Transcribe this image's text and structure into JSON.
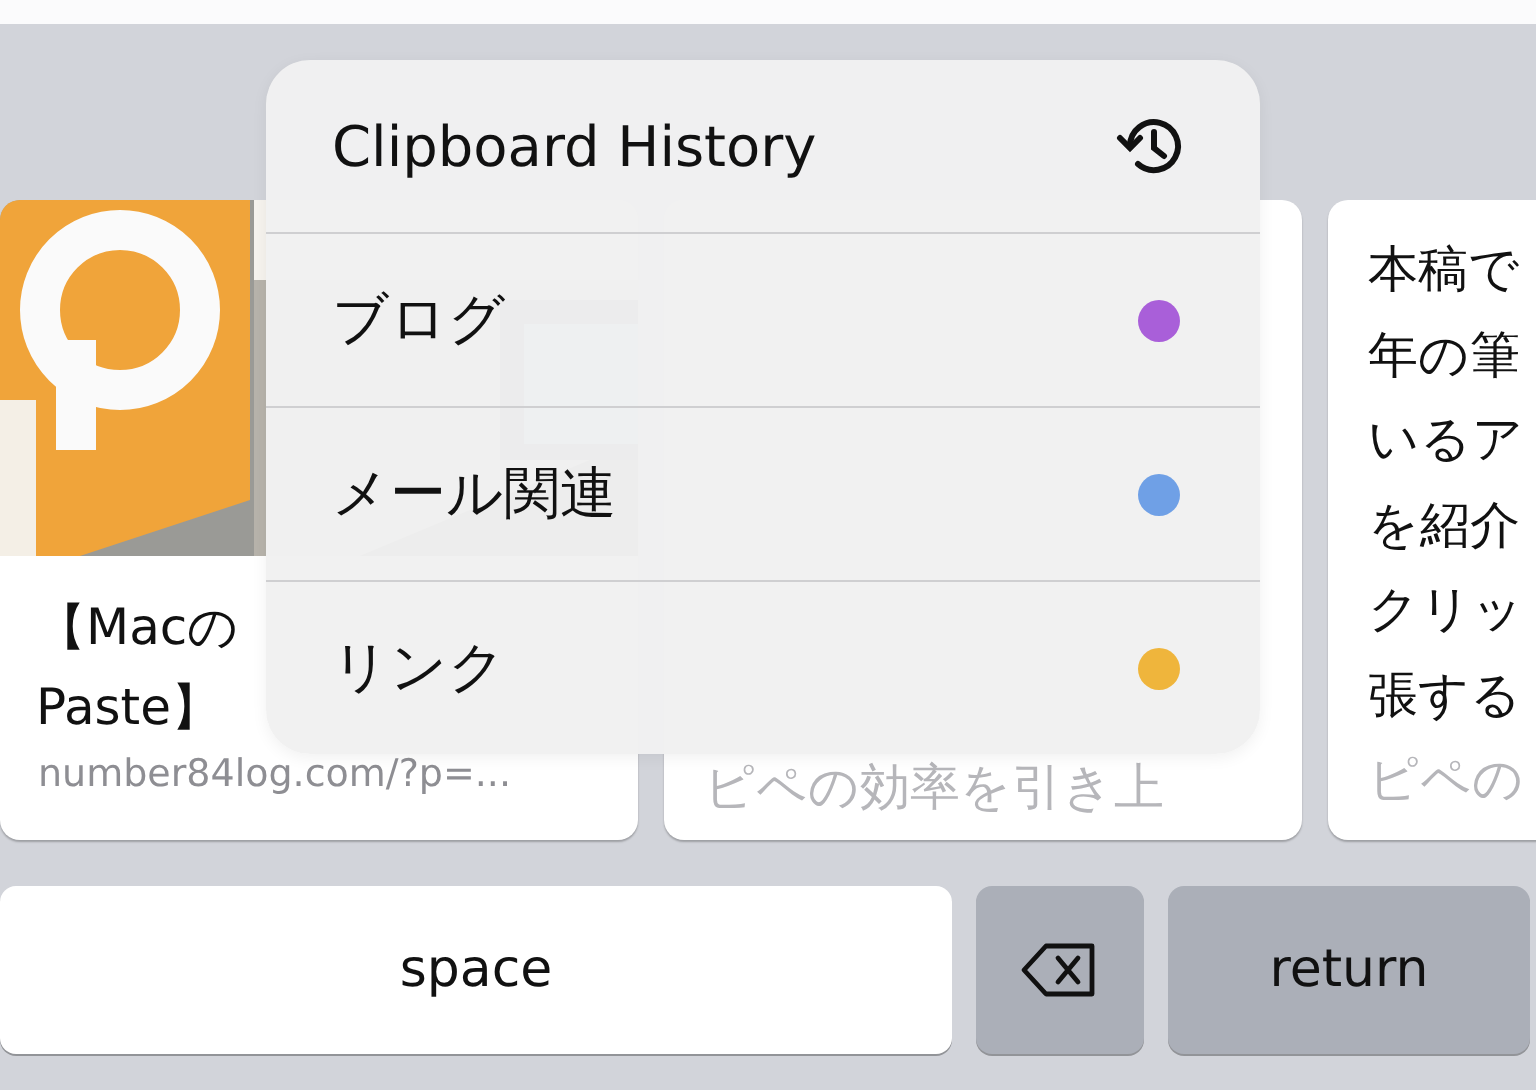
{
  "cards": [
    {
      "kind": "article",
      "title_lines": [
        "【Macの",
        "Paste】"
      ],
      "url": "number84log.com/?p=..."
    },
    {
      "kind": "text",
      "lines": [
        {
          "text": "ピペの効率を引き上",
          "faded": true
        }
      ]
    },
    {
      "kind": "text",
      "lines": [
        {
          "text": "本稿で",
          "faded": false
        },
        {
          "text": "年の筆",
          "faded": false
        },
        {
          "text": "いるア",
          "faded": false
        },
        {
          "text": "を紹介",
          "faded": false
        },
        {
          "text": "クリッ",
          "faded": false
        },
        {
          "text": "張する",
          "faded": false
        },
        {
          "text": "ピペの",
          "faded": true
        }
      ]
    }
  ],
  "clipboard_menu": {
    "title": "Clipboard History",
    "items": [
      {
        "label": "ブログ",
        "color": "#a95fd9"
      },
      {
        "label": "メール関連",
        "color": "#6fa0e6"
      },
      {
        "label": "リンク",
        "color": "#efb53c"
      }
    ]
  },
  "keyboard": {
    "keys": [
      {
        "kind": "space",
        "label": "space"
      },
      {
        "kind": "delete"
      },
      {
        "kind": "return",
        "label": "return"
      }
    ]
  }
}
